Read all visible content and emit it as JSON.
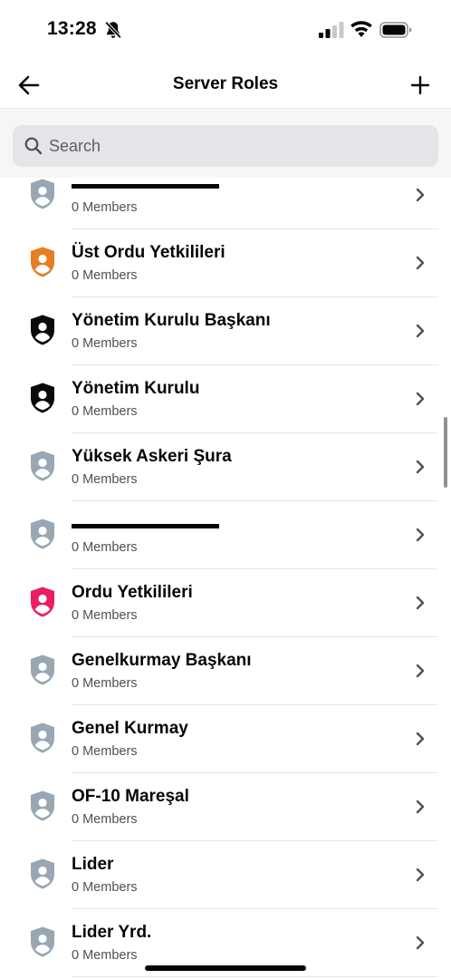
{
  "status_bar": {
    "time": "13:28",
    "icons": [
      "bell-slash-icon",
      "cellular-signal-icon",
      "wifi-icon",
      "battery-icon"
    ]
  },
  "header": {
    "title": "Server Roles",
    "back_icon": "arrow-left-icon",
    "add_icon": "plus-icon"
  },
  "search": {
    "placeholder": "Search",
    "value": "",
    "icon": "search-icon"
  },
  "colors": {
    "default_role": "#99a6b3",
    "orange_role": "#e67e22",
    "black_role": "#0a0a0a",
    "pink_role": "#e91e63",
    "search_bg": "#e4e5e8",
    "page_bg": "#ffffff",
    "search_area_bg": "#f6f6f7"
  },
  "roles": [
    {
      "name": "",
      "redacted": true,
      "members": "0 Members",
      "color": "#99a6b3"
    },
    {
      "name": "Üst Ordu Yetkilileri",
      "redacted": false,
      "members": "0 Members",
      "color": "#e67e22"
    },
    {
      "name": "Yönetim Kurulu Başkanı",
      "redacted": false,
      "members": "0 Members",
      "color": "#0a0a0a"
    },
    {
      "name": "Yönetim Kurulu",
      "redacted": false,
      "members": "0 Members",
      "color": "#0a0a0a"
    },
    {
      "name": "Yüksek Askeri Şura",
      "redacted": false,
      "members": "0 Members",
      "color": "#99a6b3"
    },
    {
      "name": "",
      "redacted": true,
      "members": "0 Members",
      "color": "#99a6b3"
    },
    {
      "name": "Ordu Yetkilileri",
      "redacted": false,
      "members": "0 Members",
      "color": "#e91e63"
    },
    {
      "name": "Genelkurmay Başkanı",
      "redacted": false,
      "members": "0 Members",
      "color": "#99a6b3"
    },
    {
      "name": "Genel Kurmay",
      "redacted": false,
      "members": "0 Members",
      "color": "#99a6b3"
    },
    {
      "name": "OF-10 Mareşal",
      "redacted": false,
      "members": "0 Members",
      "color": "#99a6b3"
    },
    {
      "name": "Lider",
      "redacted": false,
      "members": "0 Members",
      "color": "#99a6b3"
    },
    {
      "name": "Lider Yrd.",
      "redacted": false,
      "members": "0 Members",
      "color": "#99a6b3"
    }
  ]
}
